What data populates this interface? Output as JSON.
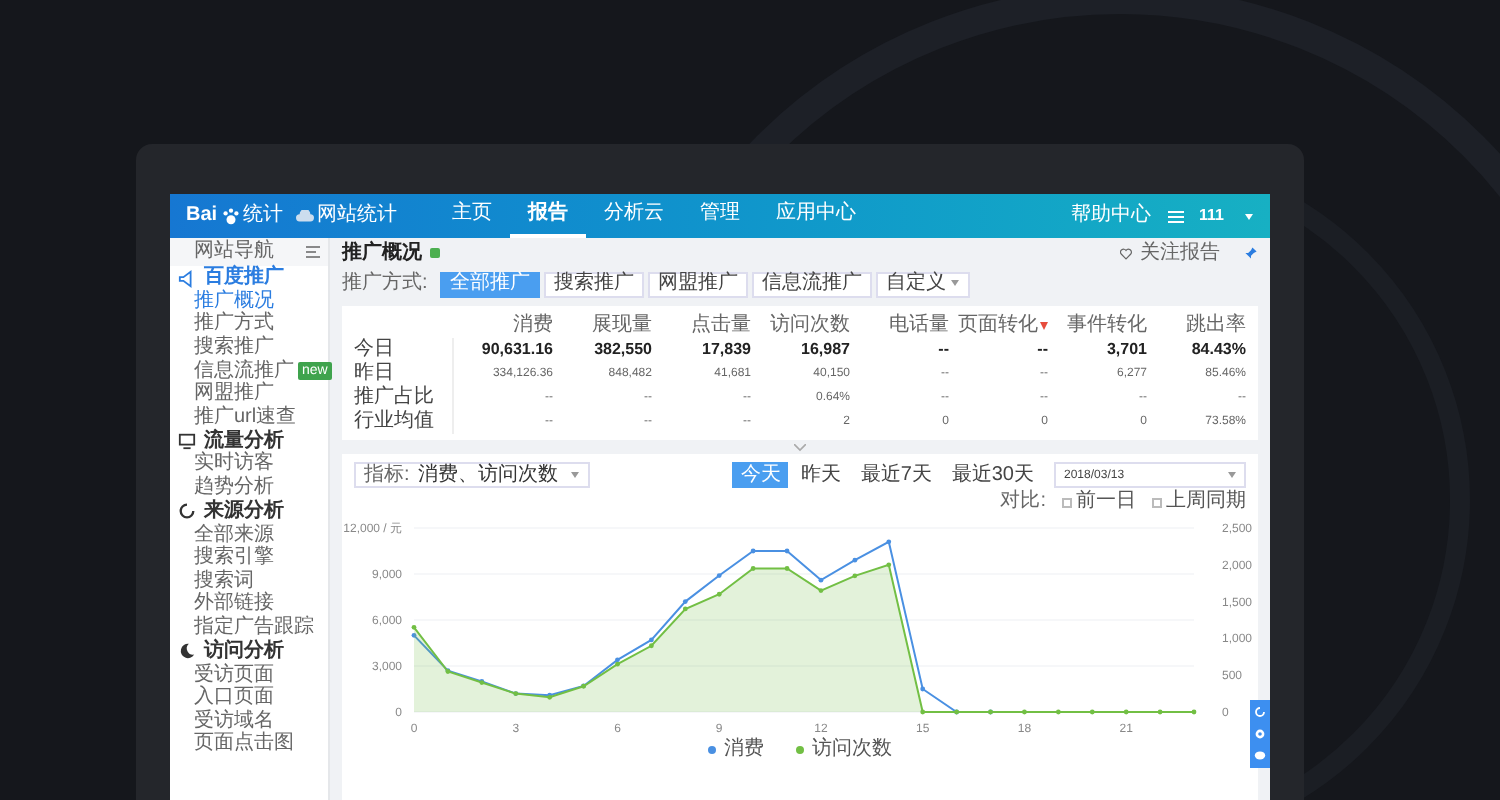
{
  "header": {
    "logo": "Bai",
    "logo_suffix": "统计",
    "product": "网站统计",
    "nav": [
      {
        "label": "主页",
        "selected": false
      },
      {
        "label": "报告",
        "selected": true
      },
      {
        "label": "分析云",
        "selected": false
      },
      {
        "label": "管理",
        "selected": false
      },
      {
        "label": "应用中心",
        "selected": false
      }
    ],
    "help": "帮助中心",
    "user": "111"
  },
  "sidebar": {
    "title": "网站导航",
    "sections": [
      {
        "label": "百度推广",
        "active": true,
        "children": [
          {
            "label": "推广概况",
            "selected": true
          },
          {
            "label": "推广方式",
            "selected": false
          },
          {
            "label": "搜索推广",
            "selected": false
          },
          {
            "label": "信息流推广",
            "selected": false,
            "badge": "new"
          },
          {
            "label": "网盟推广",
            "selected": false
          },
          {
            "label": "推广url速查",
            "selected": false
          }
        ]
      },
      {
        "label": "流量分析",
        "active": false,
        "children": [
          {
            "label": "实时访客",
            "selected": false
          },
          {
            "label": "趋势分析",
            "selected": false
          }
        ]
      },
      {
        "label": "来源分析",
        "active": false,
        "children": [
          {
            "label": "全部来源",
            "selected": false
          },
          {
            "label": "搜索引擎",
            "selected": false
          },
          {
            "label": "搜索词",
            "selected": false
          },
          {
            "label": "外部链接",
            "selected": false
          },
          {
            "label": "指定广告跟踪",
            "selected": false
          }
        ]
      },
      {
        "label": "访问分析",
        "active": false,
        "children": [
          {
            "label": "受访页面",
            "selected": false
          },
          {
            "label": "入口页面",
            "selected": false
          },
          {
            "label": "受访域名",
            "selected": false
          },
          {
            "label": "页面点击图",
            "selected": false
          }
        ]
      }
    ]
  },
  "page": {
    "title": "推广概况",
    "follow": "关注报告",
    "filter_label": "推广方式:",
    "filters": [
      {
        "label": "全部推广",
        "selected": true
      },
      {
        "label": "搜索推广",
        "selected": false
      },
      {
        "label": "网盟推广",
        "selected": false
      },
      {
        "label": "信息流推广",
        "selected": false
      },
      {
        "label": "自定义",
        "selected": false
      }
    ]
  },
  "table": {
    "columns": [
      "消费",
      "展现量",
      "点击量",
      "访问次数",
      "电话量",
      "页面转化",
      "事件转化",
      "跳出率"
    ],
    "rows": [
      {
        "label": "今日",
        "bold": true,
        "cells": [
          "90,631.16",
          "382,550",
          "17,839",
          "16,987",
          "--",
          "--",
          "3,701",
          "84.43%"
        ]
      },
      {
        "label": "昨日",
        "bold": false,
        "cells": [
          "334,126.36",
          "848,482",
          "41,681",
          "40,150",
          "--",
          "--",
          "6,277",
          "85.46%"
        ]
      },
      {
        "label": "推广占比",
        "bold": false,
        "cells": [
          "--",
          "--",
          "--",
          "0.64%",
          "--",
          "--",
          "--",
          "--"
        ]
      },
      {
        "label": "行业均值",
        "bold": false,
        "cells": [
          "--",
          "--",
          "--",
          "2",
          "0",
          "0",
          "0",
          "73.58%"
        ]
      }
    ]
  },
  "chart_panel": {
    "metric_label": "指标:",
    "metric_value": "消费、访问次数",
    "ranges": [
      {
        "label": "今天",
        "selected": true
      },
      {
        "label": "昨天",
        "selected": false
      },
      {
        "label": "最近7天",
        "selected": false
      },
      {
        "label": "最近30天",
        "selected": false
      }
    ],
    "date": "2018/03/13",
    "compare_label": "对比:",
    "compare": [
      {
        "label": "前一日",
        "checked": false
      },
      {
        "label": "上周同期",
        "checked": false
      }
    ],
    "chart_data": {
      "type": "line",
      "x": [
        0,
        1,
        2,
        3,
        4,
        5,
        6,
        7,
        8,
        9,
        10,
        11,
        12,
        13,
        14,
        15,
        16,
        17,
        18,
        19,
        20,
        21,
        22,
        23
      ],
      "xticks": [
        0,
        3,
        6,
        9,
        12,
        15,
        18,
        21
      ],
      "xlim": [
        0,
        23
      ],
      "grid": true,
      "legend": "bottom",
      "ylim": [
        0,
        12000
      ],
      "yticks": [
        0,
        {
          "value": 3000,
          "label": "3,000"
        },
        {
          "value": 6000,
          "label": "6,000"
        },
        {
          "value": 9000,
          "label": "9,000"
        },
        {
          "value": 12000,
          "label": "12,000 / 元"
        }
      ],
      "y2lim": [
        0,
        2500
      ],
      "y2ticks": [
        0,
        {
          "value": 500,
          "label": "500"
        },
        {
          "value": 1000,
          "label": "1,000"
        },
        {
          "value": 1500,
          "label": "1,500"
        },
        {
          "value": 2000,
          "label": "2,000"
        },
        {
          "value": 2500,
          "label": "2,500"
        }
      ],
      "series": [
        {
          "name": "消费",
          "color": "#4a90e2",
          "values": [
            5000,
            2700,
            2000,
            1200,
            1100,
            1700,
            3400,
            4700,
            7200,
            8900,
            10500,
            10500,
            8600,
            9900,
            11100,
            1500,
            0,
            0,
            null,
            null,
            null,
            null,
            null,
            null
          ]
        },
        {
          "name": "访问次数",
          "color": "#72bf44",
          "axis": "y2",
          "values": [
            1150,
            550,
            400,
            250,
            200,
            350,
            650,
            900,
            1400,
            1600,
            1950,
            1950,
            1650,
            1850,
            2000,
            0,
            0,
            0,
            0,
            0,
            0,
            0,
            0,
            0
          ]
        }
      ]
    }
  }
}
